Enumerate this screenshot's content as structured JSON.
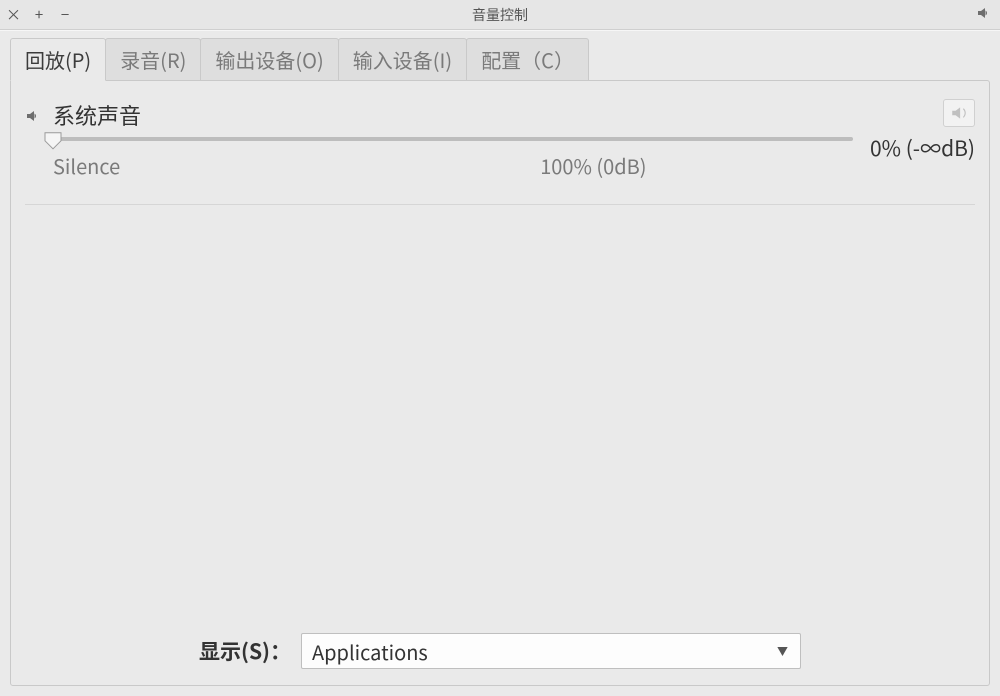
{
  "window": {
    "title": "音量控制"
  },
  "tabs": [
    {
      "label": "回放(P)",
      "active": true
    },
    {
      "label": "录音(R)",
      "active": false
    },
    {
      "label": "输出设备(O)",
      "active": false
    },
    {
      "label": "输入设备(I)",
      "active": false
    },
    {
      "label": "配置（C）",
      "active": false
    }
  ],
  "playback": {
    "stream": {
      "name": "系统声音",
      "level_text": "0% (-∞dB)",
      "slider": {
        "min_label": "Silence",
        "mid_label": "100% (0dB)",
        "value_percent": 0
      }
    }
  },
  "footer": {
    "show_label": "显示(S)：",
    "show_value": "Applications"
  }
}
